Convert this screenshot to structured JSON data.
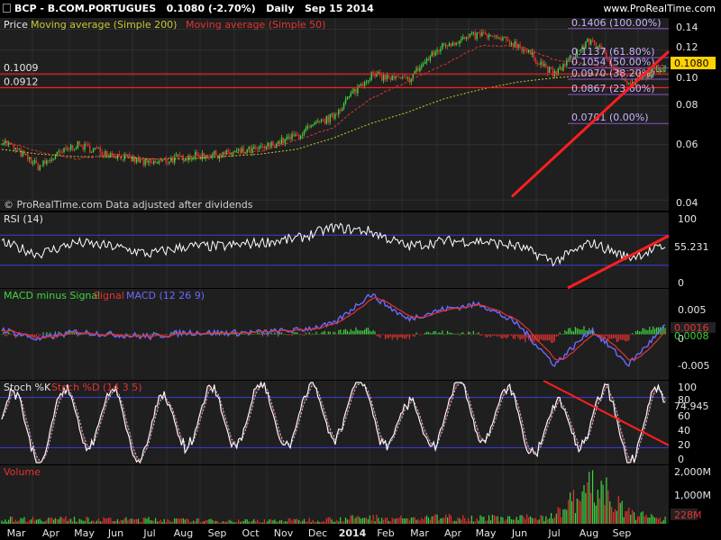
{
  "header": {
    "symbol": "BCP",
    "name": "B.COM.PORTUGUES",
    "price": "0.1080",
    "change": "(-2.70%)",
    "period": "Daily",
    "date": "Sep 15 2014",
    "brand": "www.ProRealTime.com"
  },
  "colors": {
    "candle_up": "#3fd43f",
    "candle_down": "#e63232",
    "ma200": "#c8c832",
    "ma50": "#e63232",
    "trendline": "#ff1e1e",
    "rsi": "#ffffff",
    "band": "#3c3cdc",
    "fib": "#8c50c8",
    "price_tag": "#ffd200"
  },
  "price_panel": {
    "legend_price": "Price",
    "legend_ma200": "Moving average (Simple 200)",
    "legend_ma50": "Moving average (Simple 50)",
    "watermark": "© ProRealTime.com  Data adjusted after dividends",
    "last_price": "0.1080",
    "ticks": [
      "0.14",
      "0.12",
      "0.10",
      "0.08",
      "0.06",
      "0.04"
    ],
    "h_levels": [
      {
        "value": 0.1009,
        "label": "0.1009"
      },
      {
        "value": 0.0912,
        "label": "0.0912"
      }
    ],
    "fib_levels": [
      {
        "value": 0.1406,
        "label": "0.1406 (100.00%)"
      },
      {
        "value": 0.1137,
        "label": "0.1137 (61.80%)"
      },
      {
        "value": 0.1054,
        "label": "0.1054 (50.00%)"
      },
      {
        "value": 0.097,
        "label": "0.0970 (38.20%)"
      },
      {
        "value": 0.0867,
        "label": "0.0867 (23.60%)"
      },
      {
        "value": 0.0701,
        "label": "0.0701 (0.00%)"
      }
    ]
  },
  "rsi_panel": {
    "legend": "RSI (14)",
    "ticks": [
      "100",
      "0"
    ],
    "last_value": "55.231"
  },
  "macd_panel": {
    "legend_hist": "MACD minus Signal",
    "legend_signal": "Signal",
    "legend_macd": "MACD (12 26 9)",
    "ticks": [
      "0.005",
      "0",
      "-0.005"
    ],
    "last_macd": "0.0016",
    "last_hist": "0.0008"
  },
  "stoch_panel": {
    "legend_k": "Stoch %K",
    "legend_d": "Stoch %D (14 3 5)",
    "ticks": [
      "100",
      "80",
      "60",
      "40",
      "20",
      "0"
    ],
    "last_value": "74.945"
  },
  "volume_panel": {
    "legend": "Volume",
    "ticks": [
      "2,000M",
      "1,000M"
    ],
    "last_value": "228M"
  },
  "x_axis": {
    "labels": [
      "Mar",
      "Apr",
      "May",
      "Jun",
      "Jul",
      "Aug",
      "Sep",
      "Oct",
      "Nov",
      "Dec",
      "2014",
      "Feb",
      "Mar",
      "Apr",
      "May",
      "Jun",
      "Jul",
      "Aug",
      "Sep"
    ]
  },
  "chart_data": {
    "type": "candlestick",
    "title": "BCP - B.COM.PORTUGUES  0.1080 (-2.70%)  Daily  Sep 15 2014",
    "scale": "log",
    "ylim": [
      0.037,
      0.152
    ],
    "x": [
      "2013-03",
      "2013-04",
      "2013-05",
      "2013-06",
      "2013-07",
      "2013-08",
      "2013-09",
      "2013-10",
      "2013-11",
      "2013-12",
      "2014-01",
      "2014-02",
      "2014-03",
      "2014-04",
      "2014-05",
      "2014-06",
      "2014-07",
      "2014-08",
      "2014-09"
    ],
    "close": [
      0.062,
      0.051,
      0.06,
      0.056,
      0.052,
      0.055,
      0.056,
      0.058,
      0.064,
      0.074,
      0.1,
      0.096,
      0.125,
      0.135,
      0.125,
      0.1,
      0.13,
      0.092,
      0.108
    ],
    "ma200": [
      0.058,
      0.056,
      0.055,
      0.055,
      0.054,
      0.054,
      0.055,
      0.056,
      0.058,
      0.063,
      0.07,
      0.076,
      0.084,
      0.09,
      0.095,
      0.098,
      0.1,
      0.101,
      0.103
    ],
    "ma50": [
      0.062,
      0.057,
      0.054,
      0.056,
      0.054,
      0.055,
      0.056,
      0.057,
      0.062,
      0.068,
      0.084,
      0.095,
      0.108,
      0.124,
      0.124,
      0.112,
      0.108,
      0.103,
      0.108
    ],
    "rsi": [
      60,
      45,
      60,
      55,
      45,
      55,
      55,
      60,
      65,
      80,
      75,
      55,
      62,
      62,
      55,
      35,
      60,
      40,
      55
    ],
    "macd": [
      0.001,
      -0.001,
      0.0005,
      0.0,
      -0.0005,
      0.0004,
      0.0003,
      0.0004,
      0.0008,
      0.002,
      0.008,
      0.003,
      0.005,
      0.006,
      0.002,
      -0.006,
      0.001,
      -0.006,
      0.0016
    ],
    "stoch_k": [
      60,
      20,
      80,
      60,
      20,
      70,
      60,
      80,
      60,
      95,
      95,
      20,
      80,
      85,
      60,
      15,
      90,
      15,
      75
    ],
    "volume_m": [
      220,
      260,
      240,
      200,
      220,
      180,
      150,
      160,
      180,
      240,
      320,
      250,
      340,
      300,
      260,
      420,
      1900,
      520,
      228
    ],
    "trendline": [
      {
        "x": "2014-05",
        "y": 0.041
      },
      {
        "x": "2014-09",
        "y": 0.119
      }
    ],
    "resistance_stoch": [
      {
        "x": "2014-06",
        "y": 100
      },
      {
        "x": "2014-09",
        "y": 40
      }
    ],
    "h_lines": [
      0.1009,
      0.0912
    ],
    "fibonacci": [
      0.1406,
      0.1137,
      0.1054,
      0.097,
      0.0867,
      0.0701
    ]
  }
}
